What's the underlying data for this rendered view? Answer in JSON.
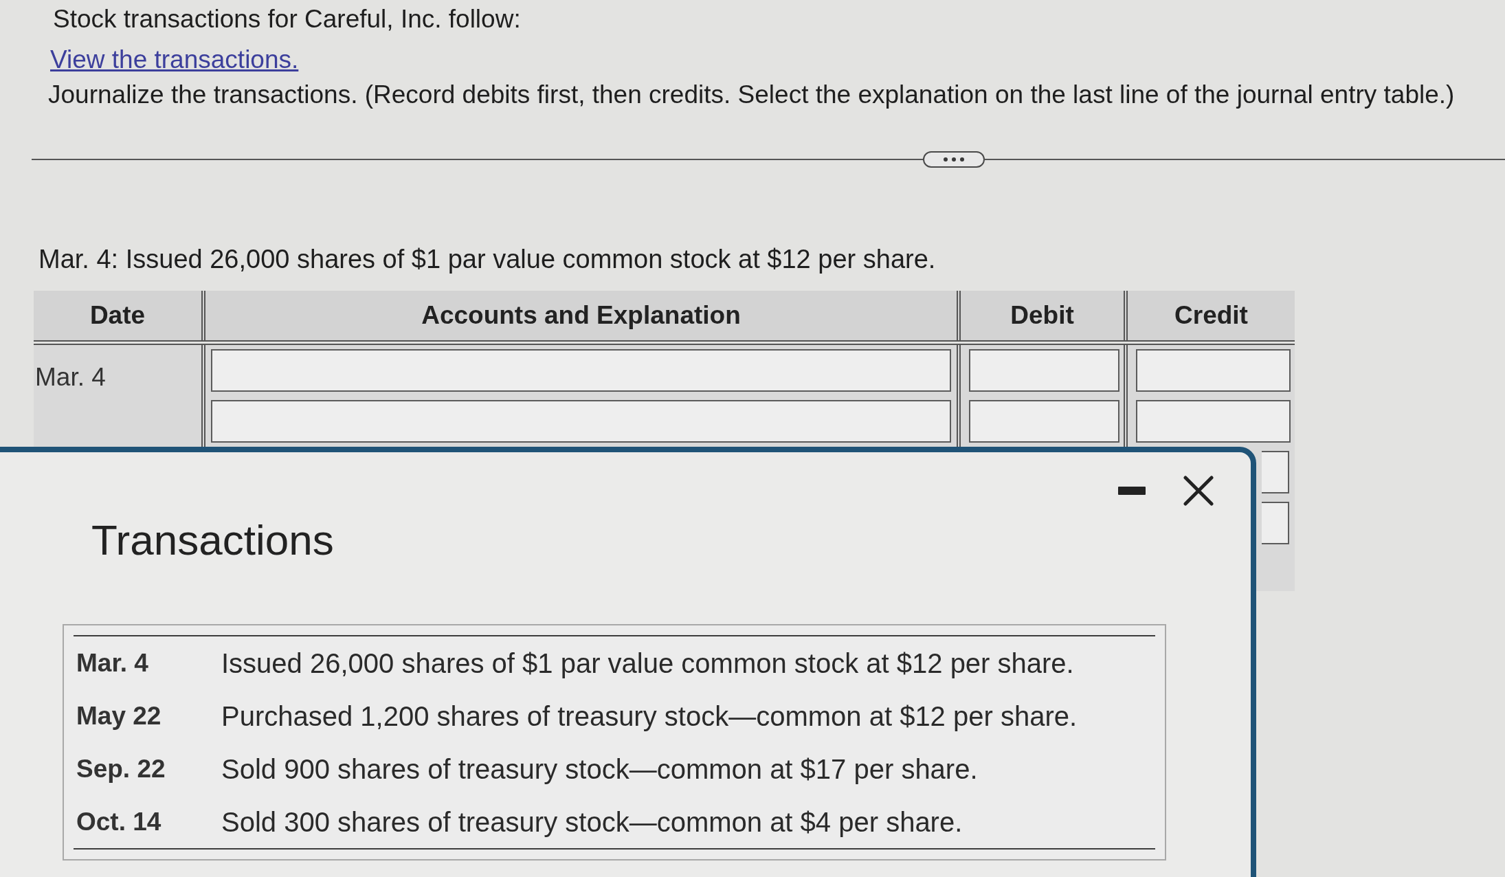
{
  "intro": {
    "text": "Stock transactions for Careful, Inc. follow:",
    "link": "View the transactions.",
    "instruction": "Journalize the transactions. (Record debits first, then credits. Select the explanation on the last line of the journal entry table.)"
  },
  "question": "Mar. 4: Issued 26,000 shares of $1 par value common stock at $12 per share.",
  "journal_table": {
    "columns": [
      "Date",
      "Accounts and Explanation",
      "Debit",
      "Credit"
    ],
    "rows": [
      {
        "kind": "entry",
        "date": "Mar. 4"
      },
      {
        "kind": "entry"
      },
      {
        "kind": "covered"
      },
      {
        "kind": "covered"
      }
    ]
  },
  "transactions_dialog": {
    "title": "Transactions",
    "items": [
      {
        "date": "Mar. 4",
        "text": "Issued 26,000 shares of $1 par value common stock at $12 per share."
      },
      {
        "date": "May 22",
        "text": "Purchased 1,200 shares of treasury stock—common at $12 per share."
      },
      {
        "date": "Sep. 22",
        "text": "Sold 900 shares of treasury stock—common at $17 per share."
      },
      {
        "date": "Oct. 14",
        "text": "Sold 300 shares of treasury stock—common at $4 per share."
      }
    ]
  }
}
